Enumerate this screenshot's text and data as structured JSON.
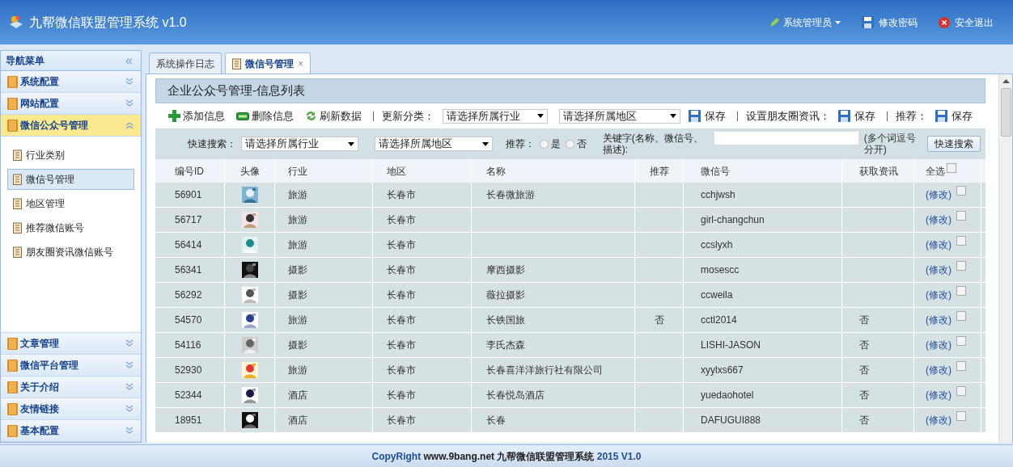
{
  "header": {
    "title": "九帮微信联盟管理系统 v1.0",
    "user": "系统管理员",
    "change_password": "修改密码",
    "logout": "安全退出"
  },
  "sidebar": {
    "title": "导航菜单",
    "collapse": "«",
    "groups": [
      {
        "label": "系统配置",
        "expanded": false
      },
      {
        "label": "网站配置",
        "expanded": false
      },
      {
        "label": "微信公众号管理",
        "expanded": true,
        "items": [
          {
            "label": "行业类别",
            "selected": false
          },
          {
            "label": "微信号管理",
            "selected": true
          },
          {
            "label": "地区管理",
            "selected": false
          },
          {
            "label": "推荐微信账号",
            "selected": false
          },
          {
            "label": "朋友圈资讯微信账号",
            "selected": false
          }
        ]
      },
      {
        "label": "文章管理",
        "expanded": false
      },
      {
        "label": "微信平台管理",
        "expanded": false
      },
      {
        "label": "关于介绍",
        "expanded": false
      },
      {
        "label": "友情链接",
        "expanded": false
      },
      {
        "label": "基本配置",
        "expanded": false
      }
    ]
  },
  "tabs": [
    {
      "label": "系统操作日志",
      "selected": false
    },
    {
      "label": "微信号管理",
      "selected": true,
      "close": "×"
    }
  ],
  "panel_title": "企业公众号管理-信息列表",
  "toolbar": {
    "add": "添加信息",
    "delete": "删除信息",
    "refresh": "刷新数据",
    "update_label": "更新分类：",
    "industry_select": "请选择所属行业",
    "region_select": "请选择所属地区",
    "save": "保存",
    "moments_label": "设置朋友圈资讯：",
    "save2": "保存",
    "recommend_label": "推荐：",
    "save3": "保存"
  },
  "search": {
    "label": "快速搜索：",
    "industry_select": "请选择所属行业",
    "region_select": "请选择所属地区",
    "recommend_label": "推荐：",
    "options": [
      {
        "label": "是",
        "selected": false
      },
      {
        "label": "否",
        "selected": false
      }
    ],
    "keyword_label": "关键字(名称、微信号、描述):",
    "hint": "(多个词逗号分开)",
    "button": "快速搜索"
  },
  "table": {
    "columns": [
      "编号ID",
      "头像",
      "行业",
      "地区",
      "名称",
      "推荐",
      "微信号",
      "获取资讯",
      "全选"
    ],
    "select_all_checked": false,
    "rows": [
      {
        "id": "56901",
        "industry": "旅游",
        "region": "长春市",
        "name": "长春微旅游",
        "wechat": "cchjwsh",
        "edit": "(修改)",
        "checked": false
      },
      {
        "id": "56717",
        "industry": "旅游",
        "region": "长春市",
        "wechat": "girl-changchun",
        "edit": "(修改)",
        "checked": false
      },
      {
        "id": "56414",
        "industry": "旅游",
        "region": "长春市",
        "wechat": "ccslyxh",
        "edit": "(修改)",
        "checked": false
      },
      {
        "id": "56341",
        "industry": "摄影",
        "region": "长春市",
        "name": "摩西摄影",
        "wechat": "mosescc",
        "edit": "(修改)",
        "checked": false
      },
      {
        "id": "56292",
        "industry": "摄影",
        "region": "长春市",
        "name": "薇拉摄影",
        "wechat": "ccweila",
        "edit": "(修改)",
        "checked": false
      },
      {
        "id": "54570",
        "industry": "旅游",
        "region": "长春市",
        "name": "长铁国旅",
        "recommend": "否",
        "wechat": "cctl2014",
        "info": "否",
        "edit": "(修改)",
        "checked": false
      },
      {
        "id": "54116",
        "industry": "摄影",
        "region": "长春市",
        "name": "李氏杰森",
        "wechat": "LISHI-JASON",
        "info": "否",
        "edit": "(修改)",
        "checked": false
      },
      {
        "id": "52930",
        "industry": "旅游",
        "region": "长春市",
        "name": "长春喜洋洋旅行社有限公司",
        "wechat": "xyylxs667",
        "info": "否",
        "edit": "(修改)",
        "checked": false
      },
      {
        "id": "52344",
        "industry": "酒店",
        "region": "长春市",
        "name": "长春悦岛酒店",
        "wechat": "yuedaohotel",
        "info": "否",
        "edit": "(修改)",
        "checked": false
      },
      {
        "id": "18951",
        "industry": "酒店",
        "region": "长春市",
        "name": "长春",
        "wechat": "DAFUGUI888",
        "info": "否",
        "edit": "(修改)",
        "checked": false
      }
    ]
  },
  "footer": [
    "CopyRight",
    "www.9bang.net 九帮微信联盟管理系统",
    "2015 V1.0"
  ]
}
